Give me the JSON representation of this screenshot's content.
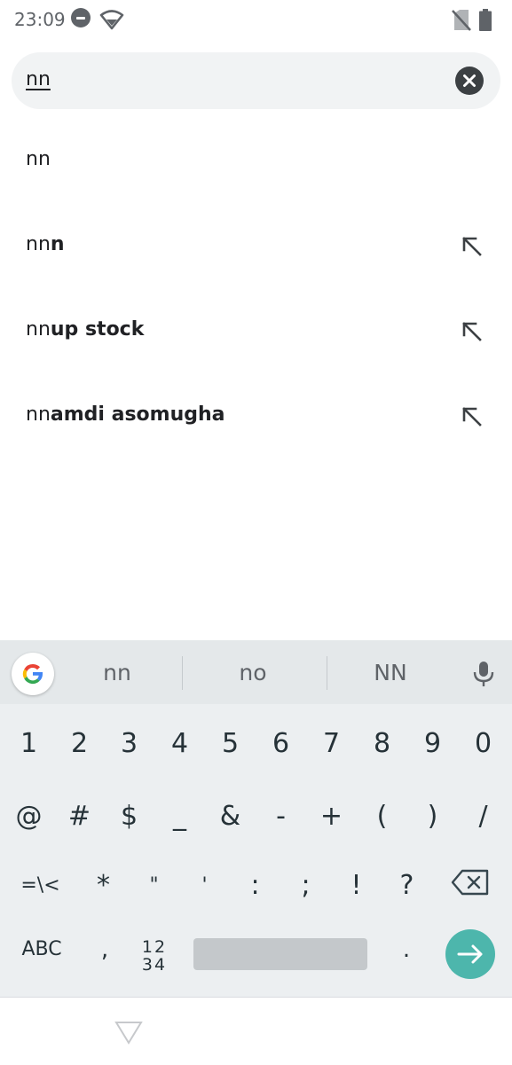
{
  "status_bar": {
    "time": "23:09"
  },
  "search": {
    "query": "nn"
  },
  "suggestions": [
    {
      "prefix": "nn",
      "completion": "",
      "has_arrow": false
    },
    {
      "prefix": "nn",
      "completion": "n",
      "has_arrow": true
    },
    {
      "prefix": "nn",
      "completion": "up stock",
      "has_arrow": true
    },
    {
      "prefix": "nn",
      "completion": "amdi asomugha",
      "has_arrow": true
    }
  ],
  "keyboard": {
    "predictions": [
      "nn",
      "no",
      "NN"
    ],
    "row1": [
      "1",
      "2",
      "3",
      "4",
      "5",
      "6",
      "7",
      "8",
      "9",
      "0"
    ],
    "row2": [
      "@",
      "#",
      "$",
      "_",
      "&",
      "-",
      "+",
      "(",
      ")",
      "/"
    ],
    "row3": [
      "=\\<",
      "*",
      "\"",
      "'",
      ":",
      ";",
      "!",
      "?"
    ],
    "abc_label": "ABC",
    "comma_label": ",",
    "numpad_line1": "12",
    "numpad_line2": "34",
    "period_label": ".",
    "accent_color": "#4db6ac"
  },
  "icons": {
    "status": [
      "dnd-icon",
      "wifi-icon",
      "no-sim-icon",
      "battery-icon"
    ],
    "search": [
      "clear-icon"
    ],
    "suggestion": "north-west-arrow-icon",
    "keyboard": [
      "google-icon",
      "mic-icon",
      "backspace-icon",
      "enter-arrow-icon"
    ],
    "nav": [
      "back-icon"
    ]
  }
}
